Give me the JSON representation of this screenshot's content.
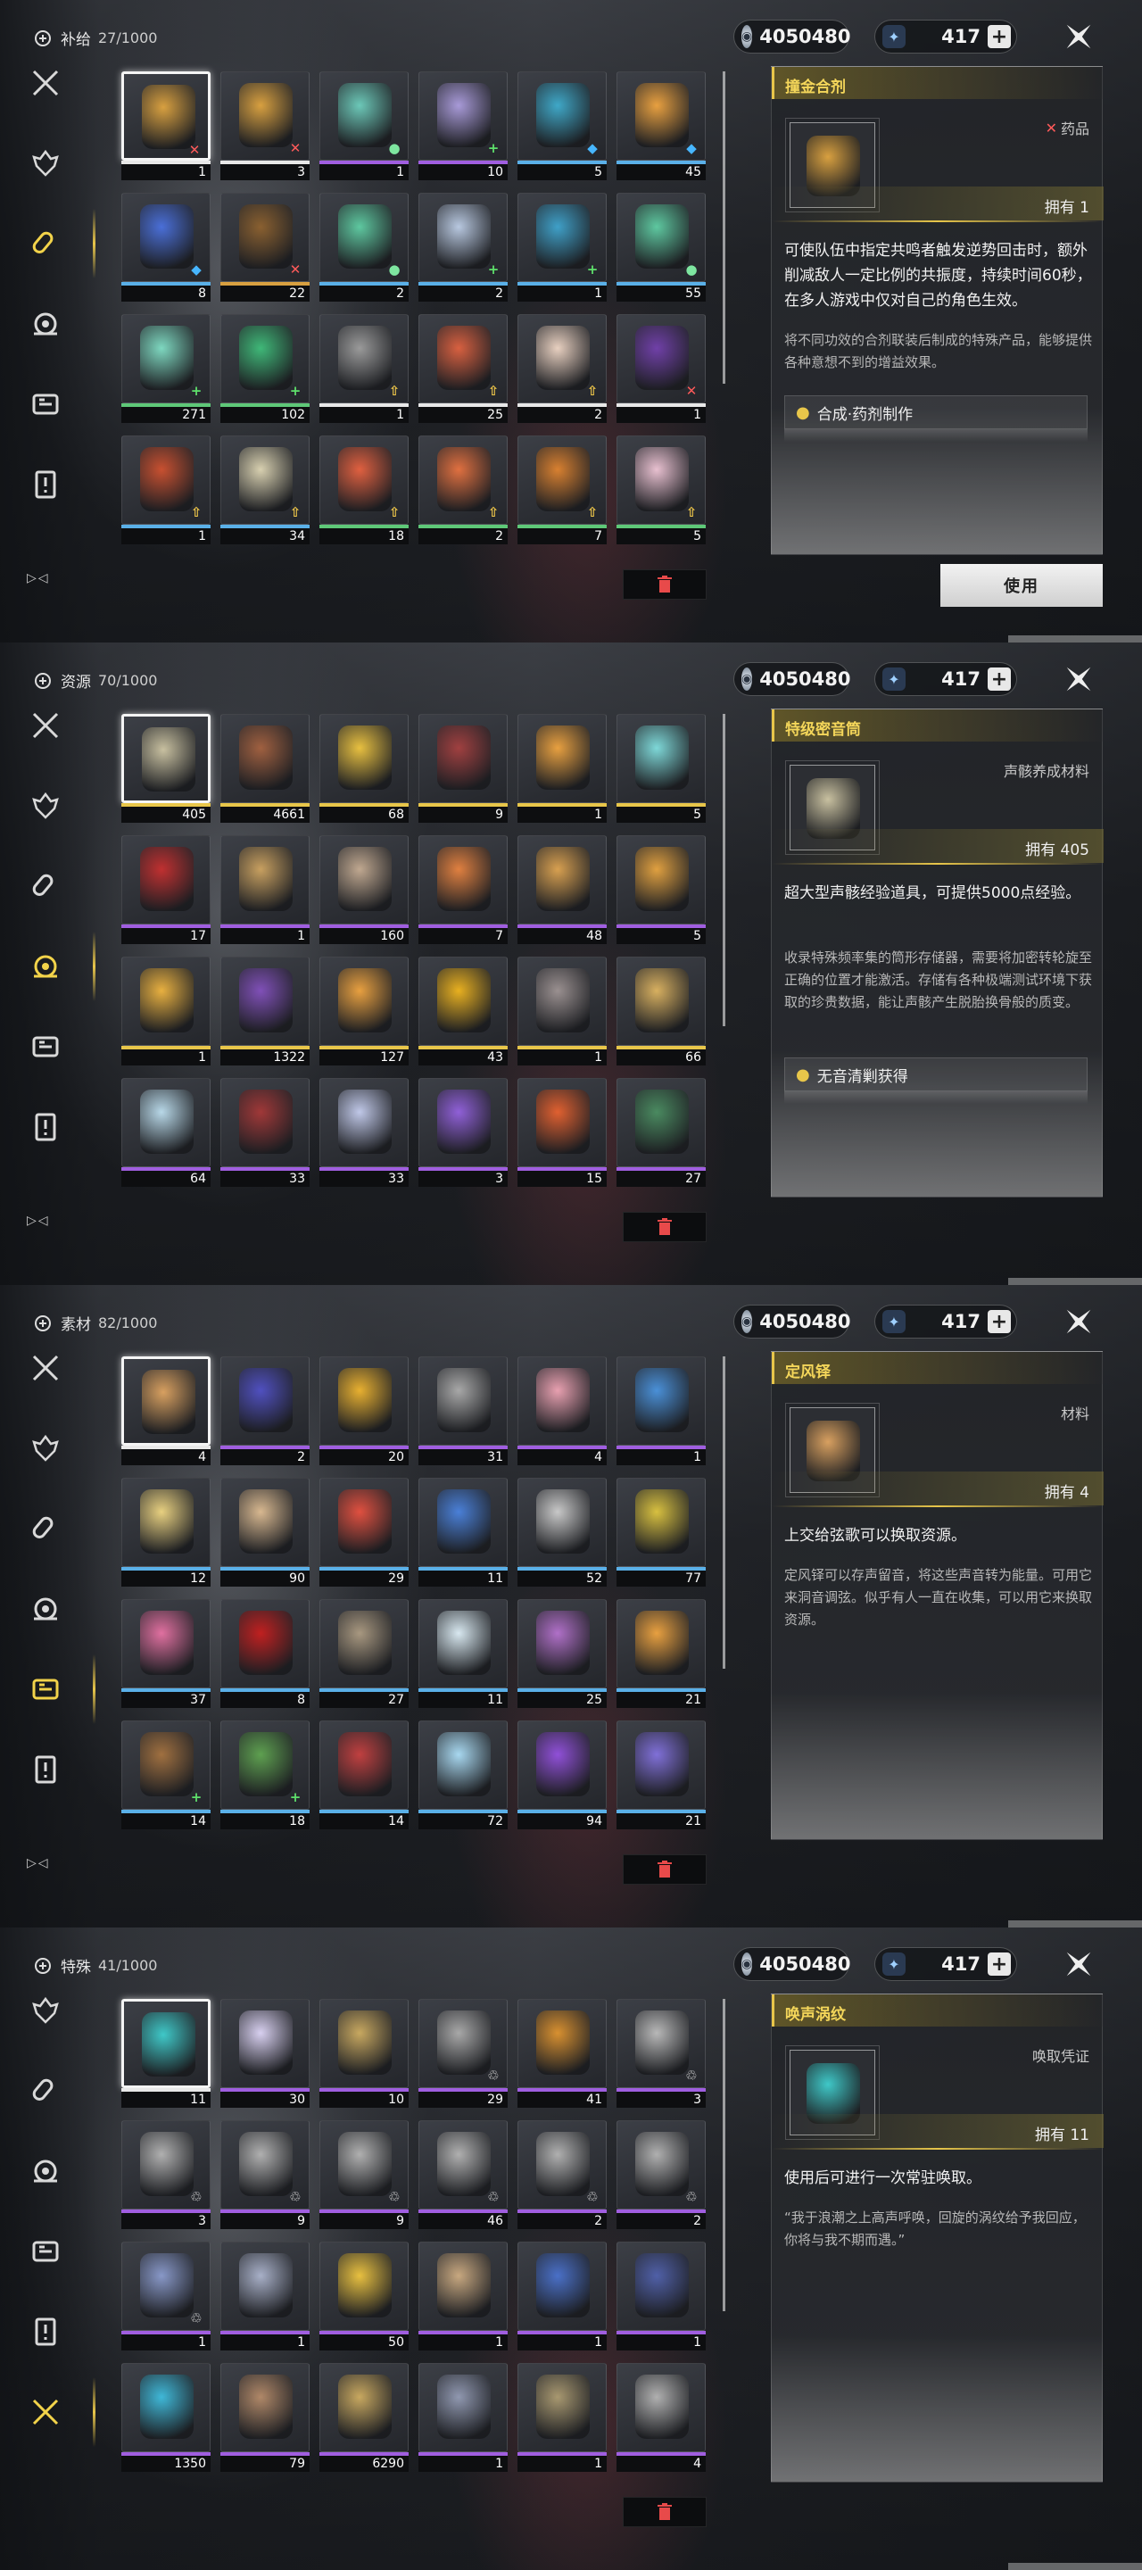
{
  "panels": [
    {
      "title": "补给",
      "count": "27/1000",
      "currency": {
        "shell": "4050480",
        "astrite": "417"
      },
      "active_tab": 2,
      "items": [
        {
          "qty": "1",
          "color": "#d8a040",
          "rarity": "#e8e8e8",
          "badge": "x",
          "selected": true
        },
        {
          "qty": "3",
          "color": "#d8a040",
          "rarity": "#e8e8e8",
          "badge": "x"
        },
        {
          "qty": "1",
          "color": "#6cc8b8",
          "rarity": "#a05ee0",
          "badge": "dot"
        },
        {
          "qty": "10",
          "color": "#a89ad8",
          "rarity": "#a05ee0",
          "badge": "plus"
        },
        {
          "qty": "5",
          "color": "#3fa8c8",
          "rarity": "#5ab0e8",
          "badge": "drop"
        },
        {
          "qty": "45",
          "color": "#e8a040",
          "rarity": "#5ab0e8",
          "badge": "drop"
        },
        {
          "qty": "8",
          "color": "#4a6fd8",
          "rarity": "#5ab0e8",
          "badge": "drop"
        },
        {
          "qty": "22",
          "color": "#8a6030",
          "rarity": "#d8a040",
          "badge": "x"
        },
        {
          "qty": "2",
          "color": "#5ec8a0",
          "rarity": "#5ab0e8",
          "badge": "dot"
        },
        {
          "qty": "2",
          "color": "#b8c8e0",
          "rarity": "#5ab0e8",
          "badge": "plus"
        },
        {
          "qty": "1",
          "color": "#3fa0c8",
          "rarity": "#5ab0e8",
          "badge": "plus"
        },
        {
          "qty": "55",
          "color": "#5ec8a0",
          "rarity": "#5ab0e8",
          "badge": "dot"
        },
        {
          "qty": "271",
          "color": "#7ed8c0",
          "rarity": "#5ec878",
          "badge": "plus"
        },
        {
          "qty": "102",
          "color": "#3fb878",
          "rarity": "#5ec878",
          "badge": "plus"
        },
        {
          "qty": "1",
          "color": "#9a9a9a",
          "rarity": "#e8e8e8",
          "badge": "up"
        },
        {
          "qty": "25",
          "color": "#d86040",
          "rarity": "#e8e8e8",
          "badge": "up"
        },
        {
          "qty": "2",
          "color": "#e8d0c0",
          "rarity": "#e8e8e8",
          "badge": "up"
        },
        {
          "qty": "1",
          "color": "#7040a8",
          "rarity": "#e8e8e8",
          "badge": "x"
        },
        {
          "qty": "1",
          "color": "#c85030",
          "rarity": "#5ab0e8",
          "badge": "up"
        },
        {
          "qty": "34",
          "color": "#d8d0b0",
          "rarity": "#5ab0e8",
          "badge": "up"
        },
        {
          "qty": "18",
          "color": "#e06040",
          "rarity": "#5ec878",
          "badge": "up"
        },
        {
          "qty": "2",
          "color": "#e07040",
          "rarity": "#5ec878",
          "badge": "up"
        },
        {
          "qty": "7",
          "color": "#d88030",
          "rarity": "#5ec878",
          "badge": "up"
        },
        {
          "qty": "5",
          "color": "#e8c0d0",
          "rarity": "#5ec878",
          "badge": "up"
        }
      ],
      "detail": {
        "name": "撞金合剂",
        "type": "药品",
        "type_badge": "x",
        "owned": "拥有 1",
        "art": "#d8a040",
        "desc": "可使队伍中指定共鸣者触发逆势回击时，额外削减敌人一定比例的共振度，持续时间60秒，在多人游戏中仅对自己的角色生效。",
        "lore": "将不同功效的合剂联装后制成的特殊产品，能够提供各种意想不到的增益效果。",
        "source": "合成·药剂制作",
        "use_label": "使用"
      }
    },
    {
      "title": "资源",
      "count": "70/1000",
      "currency": {
        "shell": "4050480",
        "astrite": "417"
      },
      "active_tab": 3,
      "items": [
        {
          "qty": "405",
          "color": "#c8c0a0",
          "rarity": "#e8c64a",
          "badge": "",
          "selected": true
        },
        {
          "qty": "4661",
          "color": "#a06040",
          "rarity": "#e8c64a",
          "badge": ""
        },
        {
          "qty": "68",
          "color": "#e8c040",
          "rarity": "#e8c64a",
          "badge": ""
        },
        {
          "qty": "9",
          "color": "#a04040",
          "rarity": "#e8c64a",
          "badge": ""
        },
        {
          "qty": "1",
          "color": "#e8a040",
          "rarity": "#e8c64a",
          "badge": ""
        },
        {
          "qty": "5",
          "color": "#7ed8d8",
          "rarity": "#e8c64a",
          "badge": ""
        },
        {
          "qty": "17",
          "color": "#c03030",
          "rarity": "#a05ee0",
          "badge": ""
        },
        {
          "qty": "1",
          "color": "#c8a060",
          "rarity": "#a05ee0",
          "badge": ""
        },
        {
          "qty": "160",
          "color": "#c0a890",
          "rarity": "#a05ee0",
          "badge": ""
        },
        {
          "qty": "7",
          "color": "#e08040",
          "rarity": "#a05ee0",
          "badge": ""
        },
        {
          "qty": "48",
          "color": "#d8a050",
          "rarity": "#a05ee0",
          "badge": ""
        },
        {
          "qty": "5",
          "color": "#e0a040",
          "rarity": "#a05ee0",
          "badge": ""
        },
        {
          "qty": "1",
          "color": "#e8b040",
          "rarity": "#e8c64a",
          "badge": ""
        },
        {
          "qty": "1322",
          "color": "#8050b8",
          "rarity": "#e8c64a",
          "badge": ""
        },
        {
          "qty": "127",
          "color": "#e8a040",
          "rarity": "#e8c64a",
          "badge": ""
        },
        {
          "qty": "43",
          "color": "#e8b020",
          "rarity": "#e8c64a",
          "badge": ""
        },
        {
          "qty": "1",
          "color": "#9a9090",
          "rarity": "#e8c64a",
          "badge": ""
        },
        {
          "qty": "66",
          "color": "#d8b060",
          "rarity": "#e8c64a",
          "badge": ""
        },
        {
          "qty": "64",
          "color": "#b8d8e8",
          "rarity": "#a05ee0",
          "badge": ""
        },
        {
          "qty": "33",
          "color": "#a03838",
          "rarity": "#a05ee0",
          "badge": ""
        },
        {
          "qty": "33",
          "color": "#c0c8e8",
          "rarity": "#a05ee0",
          "badge": ""
        },
        {
          "qty": "3",
          "color": "#9060d8",
          "rarity": "#a05ee0",
          "badge": ""
        },
        {
          "qty": "15",
          "color": "#e06030",
          "rarity": "#a05ee0",
          "badge": ""
        },
        {
          "qty": "27",
          "color": "#4a8a60",
          "rarity": "#a05ee0",
          "badge": ""
        }
      ],
      "detail": {
        "name": "特级密音筒",
        "type": "声骸养成材料",
        "type_badge": "",
        "owned": "拥有 405",
        "art": "#c8c0a0",
        "desc": "超大型声骸经验道具，可提供5000点经验。",
        "lore": "收录特殊频率集的筒形存储器，需要将加密转轮旋至正确的位置才能激活。存储有各种极端测试环境下获取的珍贵数据，能让声骸产生脱胎换骨般的质变。",
        "source": "无音清剿获得",
        "use_label": ""
      }
    },
    {
      "title": "素材",
      "count": "82/1000",
      "currency": {
        "shell": "4050480",
        "astrite": "417"
      },
      "active_tab": 4,
      "items": [
        {
          "qty": "4",
          "color": "#d8a060",
          "rarity": "#e8e8e8",
          "badge": "",
          "selected": true
        },
        {
          "qty": "2",
          "color": "#5050c0",
          "rarity": "#a05ee0",
          "badge": ""
        },
        {
          "qty": "20",
          "color": "#e8b030",
          "rarity": "#a05ee0",
          "badge": ""
        },
        {
          "qty": "31",
          "color": "#a8a8a8",
          "rarity": "#a05ee0",
          "badge": ""
        },
        {
          "qty": "4",
          "color": "#e8a0b0",
          "rarity": "#a05ee0",
          "badge": ""
        },
        {
          "qty": "1",
          "color": "#4a90d8",
          "rarity": "#a05ee0",
          "badge": ""
        },
        {
          "qty": "12",
          "color": "#e8d080",
          "rarity": "#5ab0e8",
          "badge": ""
        },
        {
          "qty": "90",
          "color": "#d8b890",
          "rarity": "#5ab0e8",
          "badge": ""
        },
        {
          "qty": "29",
          "color": "#e05040",
          "rarity": "#5ab0e8",
          "badge": ""
        },
        {
          "qty": "11",
          "color": "#4a80d8",
          "rarity": "#5ab0e8",
          "badge": ""
        },
        {
          "qty": "52",
          "color": "#c8c8c8",
          "rarity": "#5ab0e8",
          "badge": ""
        },
        {
          "qty": "77",
          "color": "#d8c040",
          "rarity": "#5ab0e8",
          "badge": ""
        },
        {
          "qty": "37",
          "color": "#e070a0",
          "rarity": "#5ab0e8",
          "badge": ""
        },
        {
          "qty": "8",
          "color": "#c02020",
          "rarity": "#5ab0e8",
          "badge": ""
        },
        {
          "qty": "27",
          "color": "#a89880",
          "rarity": "#5ab0e8",
          "badge": ""
        },
        {
          "qty": "11",
          "color": "#d8e8f0",
          "rarity": "#5ab0e8",
          "badge": ""
        },
        {
          "qty": "25",
          "color": "#b070c8",
          "rarity": "#5ab0e8",
          "badge": ""
        },
        {
          "qty": "21",
          "color": "#e8a040",
          "rarity": "#5ab0e8",
          "badge": ""
        },
        {
          "qty": "14",
          "color": "#a07040",
          "rarity": "#5ab0e8",
          "badge": "plus"
        },
        {
          "qty": "18",
          "color": "#5ea050",
          "rarity": "#5ab0e8",
          "badge": "plus"
        },
        {
          "qty": "14",
          "color": "#c04040",
          "rarity": "#5ab0e8",
          "badge": ""
        },
        {
          "qty": "72",
          "color": "#a8d8f0",
          "rarity": "#5ab0e8",
          "badge": ""
        },
        {
          "qty": "94",
          "color": "#9050d8",
          "rarity": "#5ab0e8",
          "badge": ""
        },
        {
          "qty": "21",
          "color": "#8070d8",
          "rarity": "#5ab0e8",
          "badge": ""
        }
      ],
      "detail": {
        "name": "定风铎",
        "type": "材料",
        "type_badge": "",
        "owned": "拥有 4",
        "art": "#d8a060",
        "desc": "上交给弦歌可以换取资源。",
        "lore": "定风铎可以存声留音，将这些声音转为能量。可用它来洞音调弦。似乎有人一直在收集，可以用它来换取资源。",
        "source": "",
        "use_label": ""
      }
    },
    {
      "title": "特殊",
      "count": "41/1000",
      "currency": {
        "shell": "4050480",
        "astrite": "417"
      },
      "active_tab": 5,
      "items": [
        {
          "qty": "11",
          "color": "#3fc8c8",
          "rarity": "#e8e8e8",
          "badge": "",
          "selected": true
        },
        {
          "qty": "30",
          "color": "#d8d0f0",
          "rarity": "#a05ee0",
          "badge": ""
        },
        {
          "qty": "10",
          "color": "#c8a860",
          "rarity": "#a05ee0",
          "badge": ""
        },
        {
          "qty": "29",
          "color": "#a8a8a8",
          "rarity": "#a05ee0",
          "badge": "cyc"
        },
        {
          "qty": "41",
          "color": "#d89030",
          "rarity": "#a05ee0",
          "badge": ""
        },
        {
          "qty": "3",
          "color": "#b8b8b8",
          "rarity": "#a05ee0",
          "badge": "cyc"
        },
        {
          "qty": "3",
          "color": "#b0b0b0",
          "rarity": "#a05ee0",
          "badge": "cyc"
        },
        {
          "qty": "9",
          "color": "#b0b0b0",
          "rarity": "#a05ee0",
          "badge": "cyc"
        },
        {
          "qty": "9",
          "color": "#b0b0b0",
          "rarity": "#a05ee0",
          "badge": "cyc"
        },
        {
          "qty": "46",
          "color": "#b0b0b0",
          "rarity": "#a05ee0",
          "badge": "cyc"
        },
        {
          "qty": "2",
          "color": "#b0b0b0",
          "rarity": "#a05ee0",
          "badge": "cyc"
        },
        {
          "qty": "2",
          "color": "#b0b0b0",
          "rarity": "#a05ee0",
          "badge": "cyc"
        },
        {
          "qty": "1",
          "color": "#8898c8",
          "rarity": "#a05ee0",
          "badge": "cyc"
        },
        {
          "qty": "1",
          "color": "#a8b0c8",
          "rarity": "#a05ee0",
          "badge": ""
        },
        {
          "qty": "50",
          "color": "#e8c040",
          "rarity": "#a05ee0",
          "badge": ""
        },
        {
          "qty": "1",
          "color": "#c8a880",
          "rarity": "#a05ee0",
          "badge": ""
        },
        {
          "qty": "1",
          "color": "#4a70c8",
          "rarity": "#a05ee0",
          "badge": ""
        },
        {
          "qty": "1",
          "color": "#5060a8",
          "rarity": "#a05ee0",
          "badge": ""
        },
        {
          "qty": "1350",
          "color": "#3fb8d8",
          "rarity": "#a05ee0",
          "badge": ""
        },
        {
          "qty": "79",
          "color": "#b08868",
          "rarity": "#a05ee0",
          "badge": ""
        },
        {
          "qty": "6290",
          "color": "#c8a860",
          "rarity": "#a05ee0",
          "badge": ""
        },
        {
          "qty": "1",
          "color": "#9098b0",
          "rarity": "#a05ee0",
          "badge": ""
        },
        {
          "qty": "1",
          "color": "#a89870",
          "rarity": "#a05ee0",
          "badge": ""
        },
        {
          "qty": "4",
          "color": "#b0b0b0",
          "rarity": "#a05ee0",
          "badge": ""
        }
      ],
      "detail": {
        "name": "唤声涡纹",
        "type": "唤取凭证",
        "type_badge": "",
        "owned": "拥有 11",
        "art": "#3fc8c8",
        "desc": "使用后可进行一次常驻唤取。",
        "lore": "“我于浪潮之上高声呼唤，回旋的涡纹给予我回应，你将与我不期而遇。”",
        "source": "",
        "use_label": ""
      }
    }
  ],
  "icons": {
    "shell": "shell-coin-icon",
    "astrite": "astrite-icon"
  }
}
